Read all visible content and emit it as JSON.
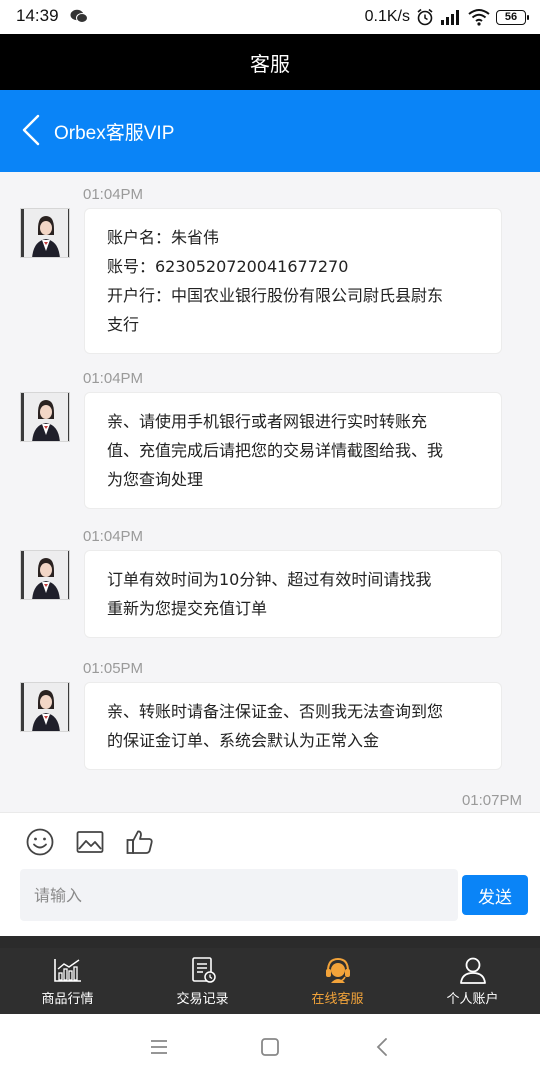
{
  "status_bar": {
    "time": "14:39",
    "network_speed": "0.1K/s",
    "battery_level": "56",
    "icons": [
      "wechat-icon",
      "alarm-icon",
      "signal-icon",
      "wifi-icon",
      "battery-icon"
    ]
  },
  "title_bar": {
    "title": "客服"
  },
  "chat_header": {
    "title": "Orbex客服VIP",
    "back_icon": "chevron-left-icon"
  },
  "messages": [
    {
      "time": "01:04PM",
      "lines": [
        "账户名：朱省伟",
        "账号：6230520720041677270",
        "开户行：中国农业银行股份有限公司尉氏县尉东",
        "支行"
      ]
    },
    {
      "time": "01:04PM",
      "lines": [
        "亲、请使用手机银行或者网银进行实时转账充",
        "值、充值完成后请把您的交易详情截图给我、我",
        "为您查询处理"
      ]
    },
    {
      "time": "01:04PM",
      "lines": [
        "订单有效时间为10分钟、超过有效时间请找我",
        "重新为您提交充值订单"
      ]
    },
    {
      "time": "01:05PM",
      "lines": [
        "亲、转账时请备注保证金、否则我无法查询到您",
        "的保证金订单、系统会默认为正常入金"
      ]
    }
  ],
  "last_time": "01:07PM",
  "composer": {
    "placeholder": "请输入",
    "send_label": "发送",
    "tools": [
      "smiley-icon",
      "image-icon",
      "thumbs-up-icon"
    ]
  },
  "tabs": [
    {
      "label": "商品行情",
      "icon": "market-chart-icon",
      "active": false
    },
    {
      "label": "交易记录",
      "icon": "trade-record-icon",
      "active": false
    },
    {
      "label": "在线客服",
      "icon": "customer-service-icon",
      "active": true
    },
    {
      "label": "个人账户",
      "icon": "user-icon",
      "active": false
    }
  ],
  "colors": {
    "primary_blue": "#0a84f7",
    "title_bar": "#000000",
    "tab_bar": "#2f2f2f",
    "tab_active": "#f2a33a"
  }
}
